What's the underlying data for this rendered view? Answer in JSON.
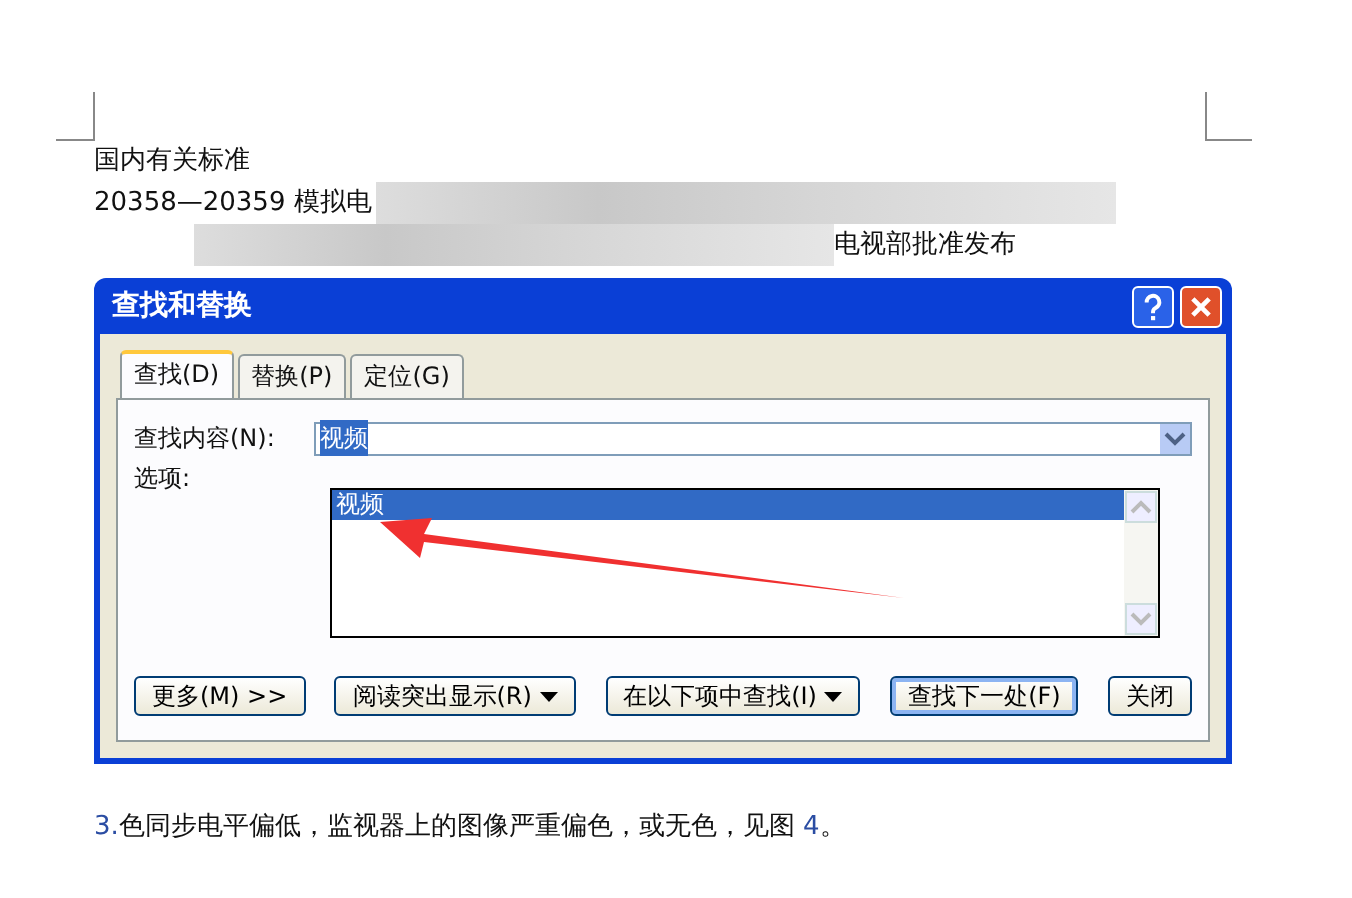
{
  "document_top": [
    {
      "text": "国内有关标准",
      "kind": "plain"
    },
    {
      "text": "20358—20359 模拟电",
      "kind": "blurred_after"
    },
    {
      "text": "电视部批准发布",
      "kind": "blurred_before"
    }
  ],
  "dialog": {
    "title": "查找和替换",
    "tabs": [
      {
        "label": "查找(D)",
        "selected": true
      },
      {
        "label": "替换(P)",
        "selected": false
      },
      {
        "label": "定位(G)",
        "selected": false
      }
    ],
    "find_label": "查找内容(N):",
    "find_value": "视频",
    "options_label": "选项:",
    "dropdown_items": [
      {
        "label": "视频",
        "selected": true
      }
    ],
    "buttons": [
      {
        "label": "更多(M) >>",
        "caret": false,
        "focused": false
      },
      {
        "label": "阅读突出显示(R)",
        "caret": true,
        "focused": false
      },
      {
        "label": "在以下项中查找(I)",
        "caret": true,
        "focused": false
      },
      {
        "label": "查找下一处(F)",
        "caret": false,
        "focused": true
      },
      {
        "label": "关闭",
        "caret": false,
        "focused": false
      }
    ]
  },
  "document_bottom": [
    {
      "parts": [
        {
          "kind": "number",
          "text": "3."
        },
        {
          "kind": "text",
          "text": "色同步电平偏低，监视器上的图像严重偏色，或无色，见图 "
        },
        {
          "kind": "number",
          "text": "4"
        },
        {
          "kind": "text",
          "text": "。"
        }
      ]
    }
  ]
}
